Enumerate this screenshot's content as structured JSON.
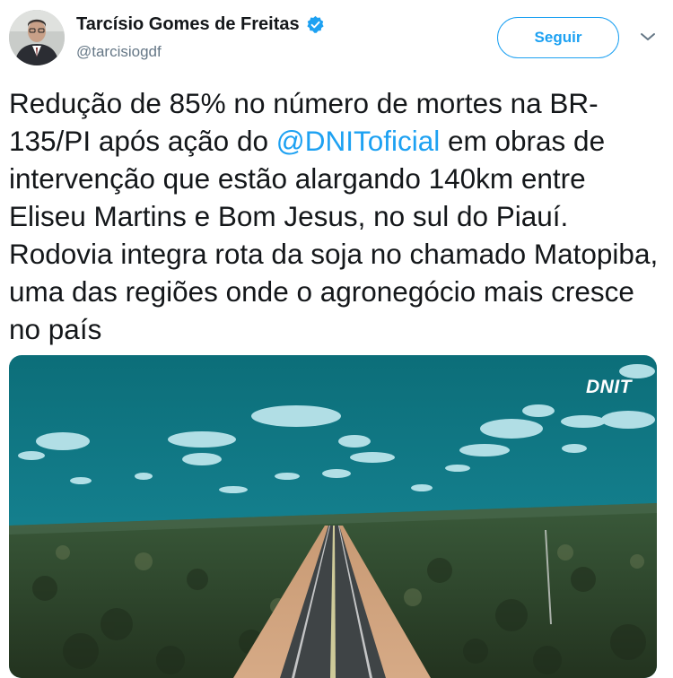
{
  "author": {
    "name": "Tarcísio Gomes de Freitas",
    "handle": "@tarcisiogdf",
    "verified": true,
    "avatar_icon": "profile-photo"
  },
  "actions": {
    "follow_label": "Seguir",
    "more_icon": "chevron-down-icon"
  },
  "tweet": {
    "text_before": "Redução de 85% no número de mortes na BR-135/PI após ação do ",
    "mention": "@DNIToficial",
    "text_after": " em obras de intervenção que estão alargando 140km entre Eliseu Martins e Bom Jesus, no sul do Piauí. Rodovia integra rota da soja no chamado Matopiba, uma das regiões onde o agronegócio mais cresce no país"
  },
  "media": {
    "watermark": "DNIT"
  },
  "colors": {
    "link": "#1da1f2",
    "text": "#14171a",
    "secondary": "#657786",
    "sky": "#0d6e7a"
  }
}
